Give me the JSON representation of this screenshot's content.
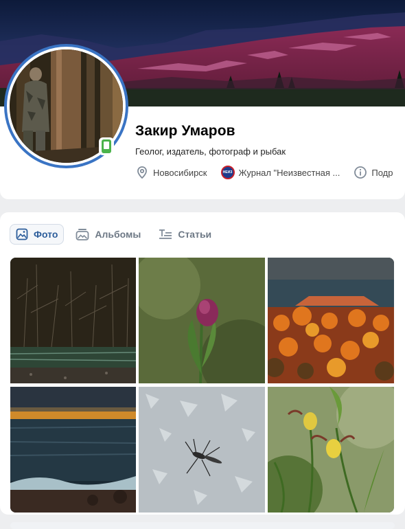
{
  "profile": {
    "name": "Закир Умаров",
    "status": "Геолог, издатель, фотограф и рыбак",
    "city": "Новосибирск",
    "journal": "Журнал \"Неизвестная ...",
    "journal_logo_text": "НЕИЗ",
    "details": "Подр",
    "online": "mobile"
  },
  "photos_tabs": [
    {
      "label": "Фото",
      "icon": "image-icon",
      "active": true
    },
    {
      "label": "Альбомы",
      "icon": "albums-icon",
      "active": false
    },
    {
      "label": "Статьи",
      "icon": "article-icon",
      "active": false
    }
  ],
  "photos": [
    {
      "subject": "river-forest-night"
    },
    {
      "subject": "lady-slipper-bud"
    },
    {
      "subject": "autumn-forest-cliff"
    },
    {
      "subject": "sea-sunset-waves"
    },
    {
      "subject": "mosquito-on-ice"
    },
    {
      "subject": "yellow-lady-slipper"
    }
  ],
  "colors": {
    "accent": "#2c5d9b",
    "avatar_ring": "#3a74c4",
    "online": "#4bb34b"
  }
}
